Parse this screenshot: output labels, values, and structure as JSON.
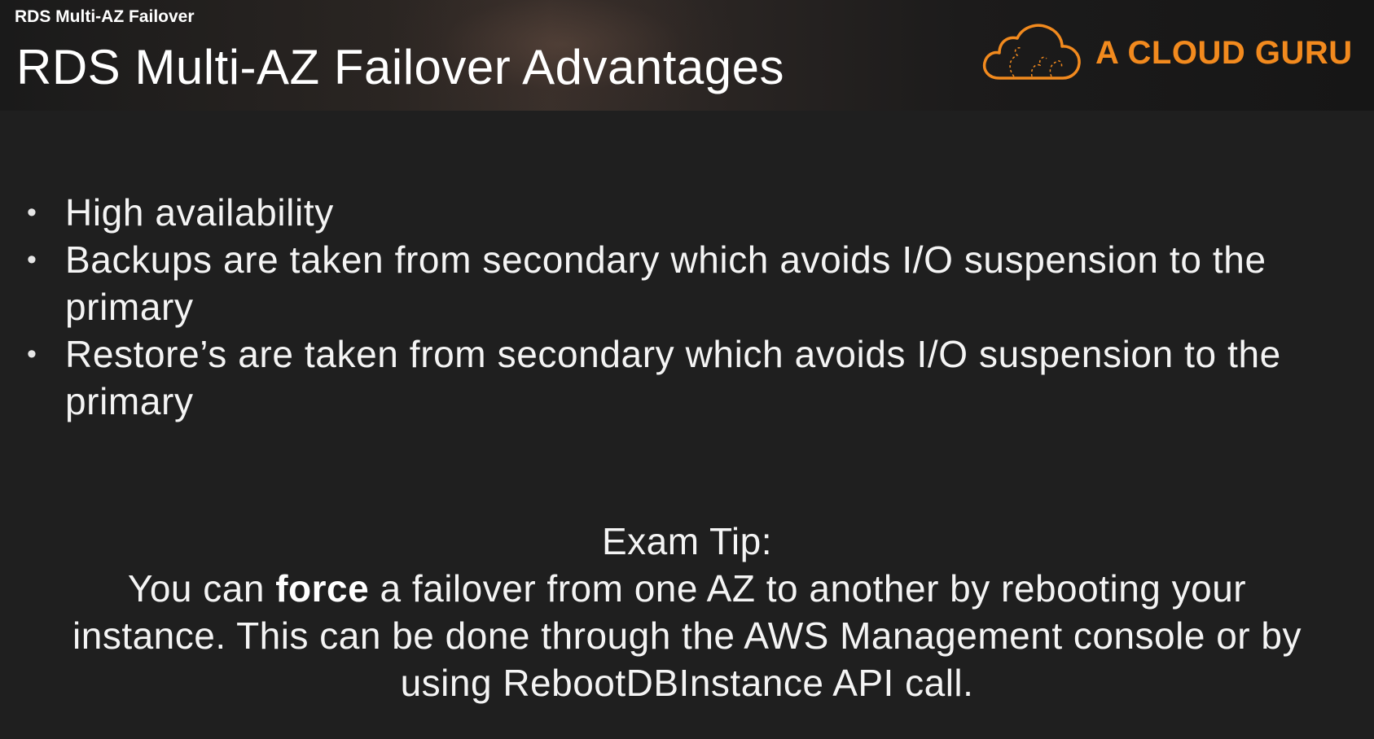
{
  "header": {
    "small_title": "RDS Multi-AZ Failover",
    "title": "RDS Multi-AZ Failover Advantages",
    "logo_text": "A CLOUD GURU",
    "logo_icon": "cloud-icon",
    "accent_color": "#f28a1e"
  },
  "bullets": [
    {
      "line1": "High availability",
      "line2": ""
    },
    {
      "line1": "Backups are taken from secondary which avoids I/O suspension to the",
      "line2": "primary"
    },
    {
      "line1": "Restore’s are taken from secondary which avoids I/O suspension to the",
      "line2": "primary"
    }
  ],
  "tip": {
    "heading": "Exam Tip:",
    "line1_pre": "You can ",
    "line1_bold": "force",
    "line1_post": " a failover from one AZ to another by rebooting your",
    "line2": "instance. This can be done through the AWS Management console or by",
    "line3": "using RebootDBInstance API call."
  }
}
